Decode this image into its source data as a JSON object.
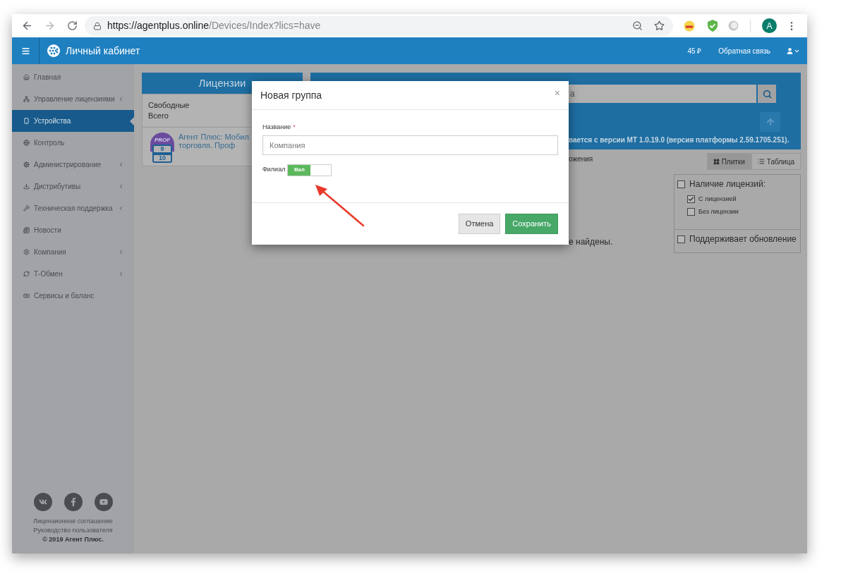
{
  "browser": {
    "url_host": "https://agentplus.online",
    "url_path": "/Devices/Index?lics=have",
    "avatar": "A"
  },
  "header": {
    "title": "Личный кабинет",
    "balance": "45 ₽",
    "feedback": "Обратная связь"
  },
  "sidebar": {
    "items": [
      {
        "label": "Главная",
        "selected": false,
        "expandable": false
      },
      {
        "label": "Управление лицензиями",
        "selected": false,
        "expandable": true
      },
      {
        "label": "Устройства",
        "selected": true,
        "expandable": false
      },
      {
        "label": "Контроль",
        "selected": false,
        "expandable": false
      },
      {
        "label": "Администрирование",
        "selected": false,
        "expandable": true
      },
      {
        "label": "Дистрибутивы",
        "selected": false,
        "expandable": true
      },
      {
        "label": "Техническая поддержка",
        "selected": false,
        "expandable": true
      },
      {
        "label": "Новости",
        "selected": false,
        "expandable": false
      },
      {
        "label": "Компания",
        "selected": false,
        "expandable": true
      },
      {
        "label": "Т-Обмен",
        "selected": false,
        "expandable": true
      },
      {
        "label": "Сервисы и баланс",
        "selected": false,
        "expandable": false
      }
    ],
    "footer_links": [
      "Лицензионное соглашение",
      "Руководство пользователя"
    ],
    "copyright": "© 2019 Агент Плюс."
  },
  "licenses": {
    "title": "Лицензии",
    "rows": [
      "Свободные",
      "Всего"
    ],
    "product": {
      "badge": "PROF",
      "free": "9",
      "total": "10",
      "name_lines": [
        "Агент Плюс: Мобил",
        "торговля. Проф"
      ]
    }
  },
  "devices": {
    "search": {
      "placeholder": "а"
    },
    "notice": "вается с версии МТ 1.0.19.0 (версия платформы 2.59.1705.251).",
    "list_text": "ожения",
    "empty_text": "е найдены.",
    "view_tabs": [
      {
        "label": "Плитки",
        "selected": true
      },
      {
        "label": "Таблица",
        "selected": false
      }
    ],
    "filters": [
      {
        "label": "Наличие лицензий:",
        "checked": false,
        "children": [
          {
            "label": "С лицензией",
            "checked": true
          },
          {
            "label": "Без лицензии",
            "checked": false
          }
        ]
      },
      {
        "label": "Поддерживает обновление",
        "checked": false
      }
    ]
  },
  "modal": {
    "title": "Новая группа",
    "close": "×",
    "field": {
      "label": "Название",
      "required": "*",
      "placeholder": "Компания"
    },
    "toggle": {
      "label": "Филиал",
      "on": true,
      "on_text": "Вкл"
    },
    "buttons": [
      {
        "label": "Отмена",
        "kind": "secondary"
      },
      {
        "label": "Сохранить",
        "kind": "primary"
      }
    ]
  }
}
